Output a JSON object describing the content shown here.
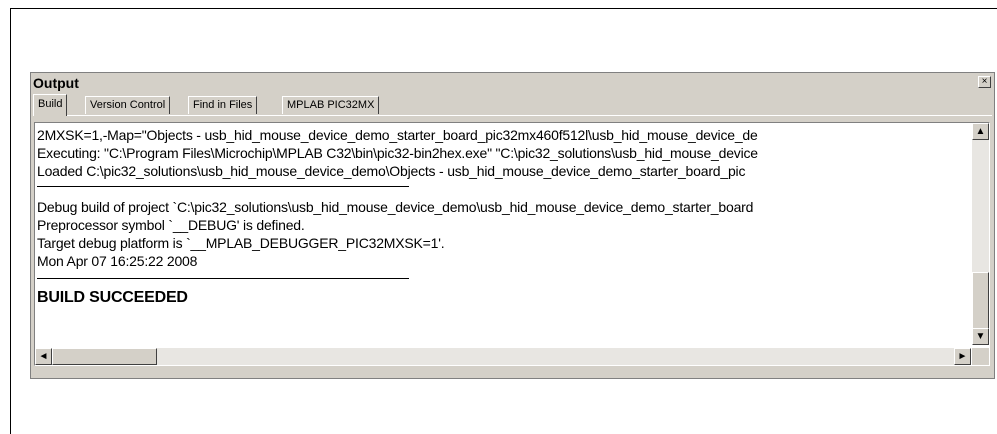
{
  "panel": {
    "title": "Output",
    "close_glyph": "×"
  },
  "tabs": [
    {
      "label": "Build",
      "active": true
    },
    {
      "label": "Version Control",
      "active": false
    },
    {
      "label": "Find in Files",
      "active": false
    },
    {
      "label": "MPLAB PIC32MX",
      "active": false
    }
  ],
  "output": {
    "lines_top": [
      "2MXSK=1,-Map=\"Objects - usb_hid_mouse_device_demo_starter_board_pic32mx460f512l\\usb_hid_mouse_device_de",
      "Executing: \"C:\\Program Files\\Microchip\\MPLAB C32\\bin\\pic32-bin2hex.exe\" \"C:\\pic32_solutions\\usb_hid_mouse_device",
      "Loaded C:\\pic32_solutions\\usb_hid_mouse_device_demo\\Objects - usb_hid_mouse_device_demo_starter_board_pic"
    ],
    "lines_mid": [
      "Debug build of project `C:\\pic32_solutions\\usb_hid_mouse_device_demo\\usb_hid_mouse_device_demo_starter_board",
      "Preprocessor symbol `__DEBUG' is defined.",
      "Target debug platform is `__MPLAB_DEBUGGER_PIC32MXSK=1'.",
      "Mon Apr 07 16:25:22 2008"
    ],
    "result": "BUILD SUCCEEDED"
  },
  "scrollbar": {
    "up_arrow": "▲",
    "down_arrow": "▼",
    "left_arrow": "◄",
    "right_arrow": "►"
  }
}
